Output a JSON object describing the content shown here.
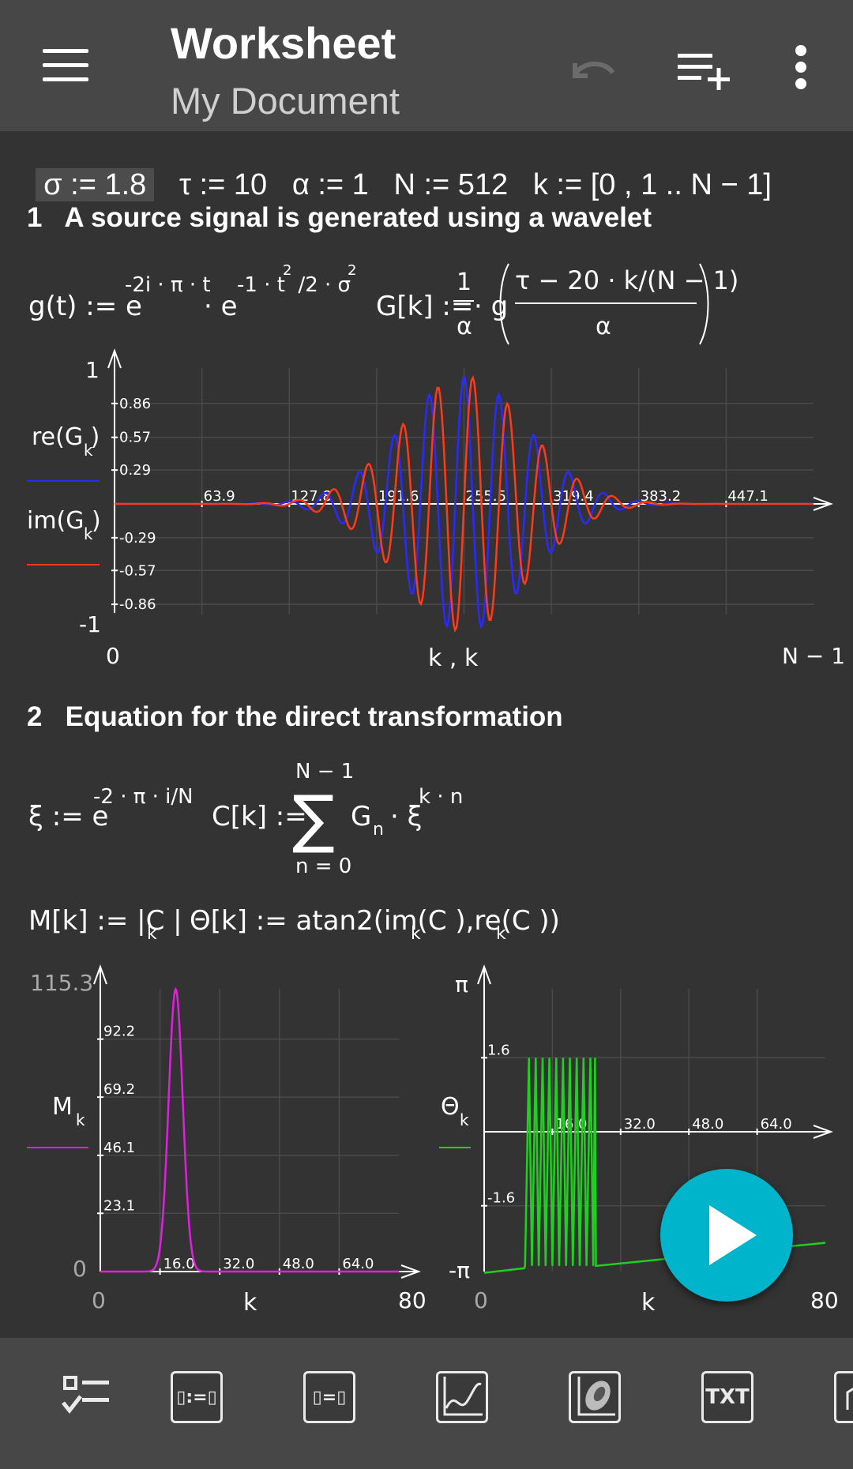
{
  "app": {
    "title": "Worksheet",
    "subtitle": "My Document"
  },
  "params": {
    "sigma": "σ := 1.8",
    "tau": "τ := 10",
    "alpha": "α := 1",
    "n": "N := 512",
    "k": "k := [0 , 1 .. N − 1]"
  },
  "section1": {
    "title": "1   A source signal is generated using a wavelet"
  },
  "formula1": {
    "g_lhs": "g(t) := e",
    "g_exp1": "-2i · π · t",
    "g_dot": "· e",
    "g_exp2": "-1 · t  /2 · σ",
    "g_sq1": "2",
    "g_sq2": "2",
    "G_lhs": "G[k] :=",
    "G_num": "1",
    "G_den": "α",
    "G_mid": "· g",
    "G_inner_num": "τ − 20 · k/(N − 1)",
    "G_inner_den": "α"
  },
  "plot1": {
    "y_max_label": "1",
    "y_min_label": "-1",
    "x_min_label": "0",
    "x_max_label": "N − 1",
    "x_axis_label": "k , k",
    "legend_re": "re(G )",
    "legend_re_sub": "k",
    "legend_im": "im(G )",
    "legend_im_sub": "k",
    "y_ticks": [
      "0.86",
      "0.57",
      "0.29",
      "-0.29",
      "-0.57",
      "-0.86"
    ],
    "x_ticks": [
      "63.9",
      "127.8",
      "191.6",
      "255.5",
      "319.4",
      "383.2",
      "447.1"
    ],
    "colors": {
      "re": "#2a2aff",
      "im": "#ff3a1a"
    }
  },
  "section2": {
    "title": "2   Equation for the direct transformation"
  },
  "formula2": {
    "xi_lhs": "ξ := e",
    "xi_exp": "-2 · π · i/N",
    "C_lhs": "C[k] :=",
    "sum_top": "N − 1",
    "sum_bottom": "n = 0",
    "sigma_sym": "∑",
    "C_term": "G",
    "C_term_sub": "n",
    "C_term2": "· ξ",
    "C_exp": "k · n"
  },
  "formula3": {
    "M_def": "M[k] := |C |",
    "M_sub": "k",
    "theta_def": "Θ[k] := atan2(im(C ),re(C ))",
    "theta_sub1": "k",
    "theta_sub2": "k"
  },
  "plot2": {
    "y_max_label": "115.3",
    "y_min_label": "0",
    "x_min_label": "0",
    "x_max_label": "80",
    "x_axis_label": "k",
    "legend": "M",
    "legend_sub": "k",
    "y_ticks": [
      "92.2",
      "69.2",
      "46.1",
      "23.1"
    ],
    "x_ticks": [
      "16.0",
      "32.0",
      "48.0",
      "64.0"
    ],
    "color": "#e020e0"
  },
  "plot3": {
    "y_max_label": "π",
    "y_min_label": "-π",
    "x_min_label": "0",
    "x_max_label": "80",
    "x_axis_label": "k",
    "legend": "Θ",
    "legend_sub": "k",
    "y_ticks": [
      "1.6",
      "-1.6"
    ],
    "x_ticks": [
      "16.0",
      "32.0",
      "48.0",
      "64.0"
    ],
    "color": "#20d020"
  },
  "bottom_bar": {
    "text_tool_label": "TXT"
  }
}
